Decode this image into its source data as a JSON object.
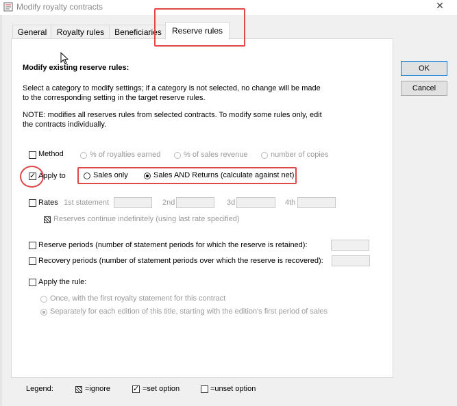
{
  "window": {
    "title": "Modify royalty contracts",
    "close_symbol": "✕"
  },
  "tabs": [
    {
      "label": "General"
    },
    {
      "label": "Royalty rules"
    },
    {
      "label": "Beneficiaries"
    },
    {
      "label": "Reserve rules"
    }
  ],
  "buttons": {
    "ok": "OK",
    "cancel": "Cancel"
  },
  "section": {
    "heading": "Modify existing reserve rules:",
    "intro_line1": "Select a category to modify settings; if a category is not selected, no change will be made",
    "intro_line2": "to the corresponding setting in the target reserve rules.",
    "note_line1": "NOTE: modifies all reserves rules from selected contracts. To modify some rules only, edit",
    "note_line2": "the contracts individually."
  },
  "method": {
    "label": "Method",
    "options": [
      "% of royalties earned",
      "% of sales revenue",
      "number of copies"
    ]
  },
  "apply_to": {
    "label": "Apply to",
    "checked": true,
    "options": [
      "Sales only",
      "Sales AND Returns (calculate against net)"
    ],
    "selected": "Sales AND Returns (calculate against net)"
  },
  "rates": {
    "label": "Rates",
    "fields": [
      "1st statement",
      "2nd",
      "3d",
      "4th"
    ],
    "continue_label": "Reserves continue indefinitely (using last rate specified)"
  },
  "reserve_periods": {
    "label": "Reserve periods (number of statement periods for which the reserve is retained):"
  },
  "recovery_periods": {
    "label": "Recovery periods (number of statement periods over which the reserve is recovered):"
  },
  "apply_rule": {
    "label": "Apply the rule:",
    "options": [
      "Once, with the first royalty statement for this contract",
      "Separately for each edition of this title, starting with the edition's first period of sales"
    ],
    "selected": "Separately for each edition of this title, starting with the edition's first period of sales"
  },
  "legend": {
    "label": "Legend:",
    "ignore": "=ignore",
    "set": "=set option",
    "unset": "=unset option"
  }
}
